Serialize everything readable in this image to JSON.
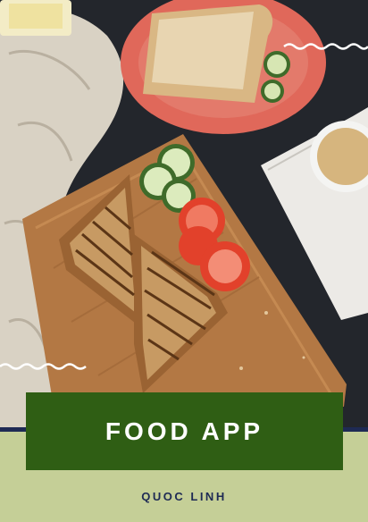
{
  "cover": {
    "title": "FOOD APP",
    "author": "QUOC LINH"
  },
  "photo": {
    "subject": "grilled sandwich on wooden board with cucumber and tomato slices, bread on red plate, coffee cup"
  },
  "colors": {
    "title_card": "#2f5e14",
    "title_text": "#ffffff",
    "bottom_band": "#c5cf97",
    "author_text": "#1e2a54",
    "background": "#23262c"
  }
}
